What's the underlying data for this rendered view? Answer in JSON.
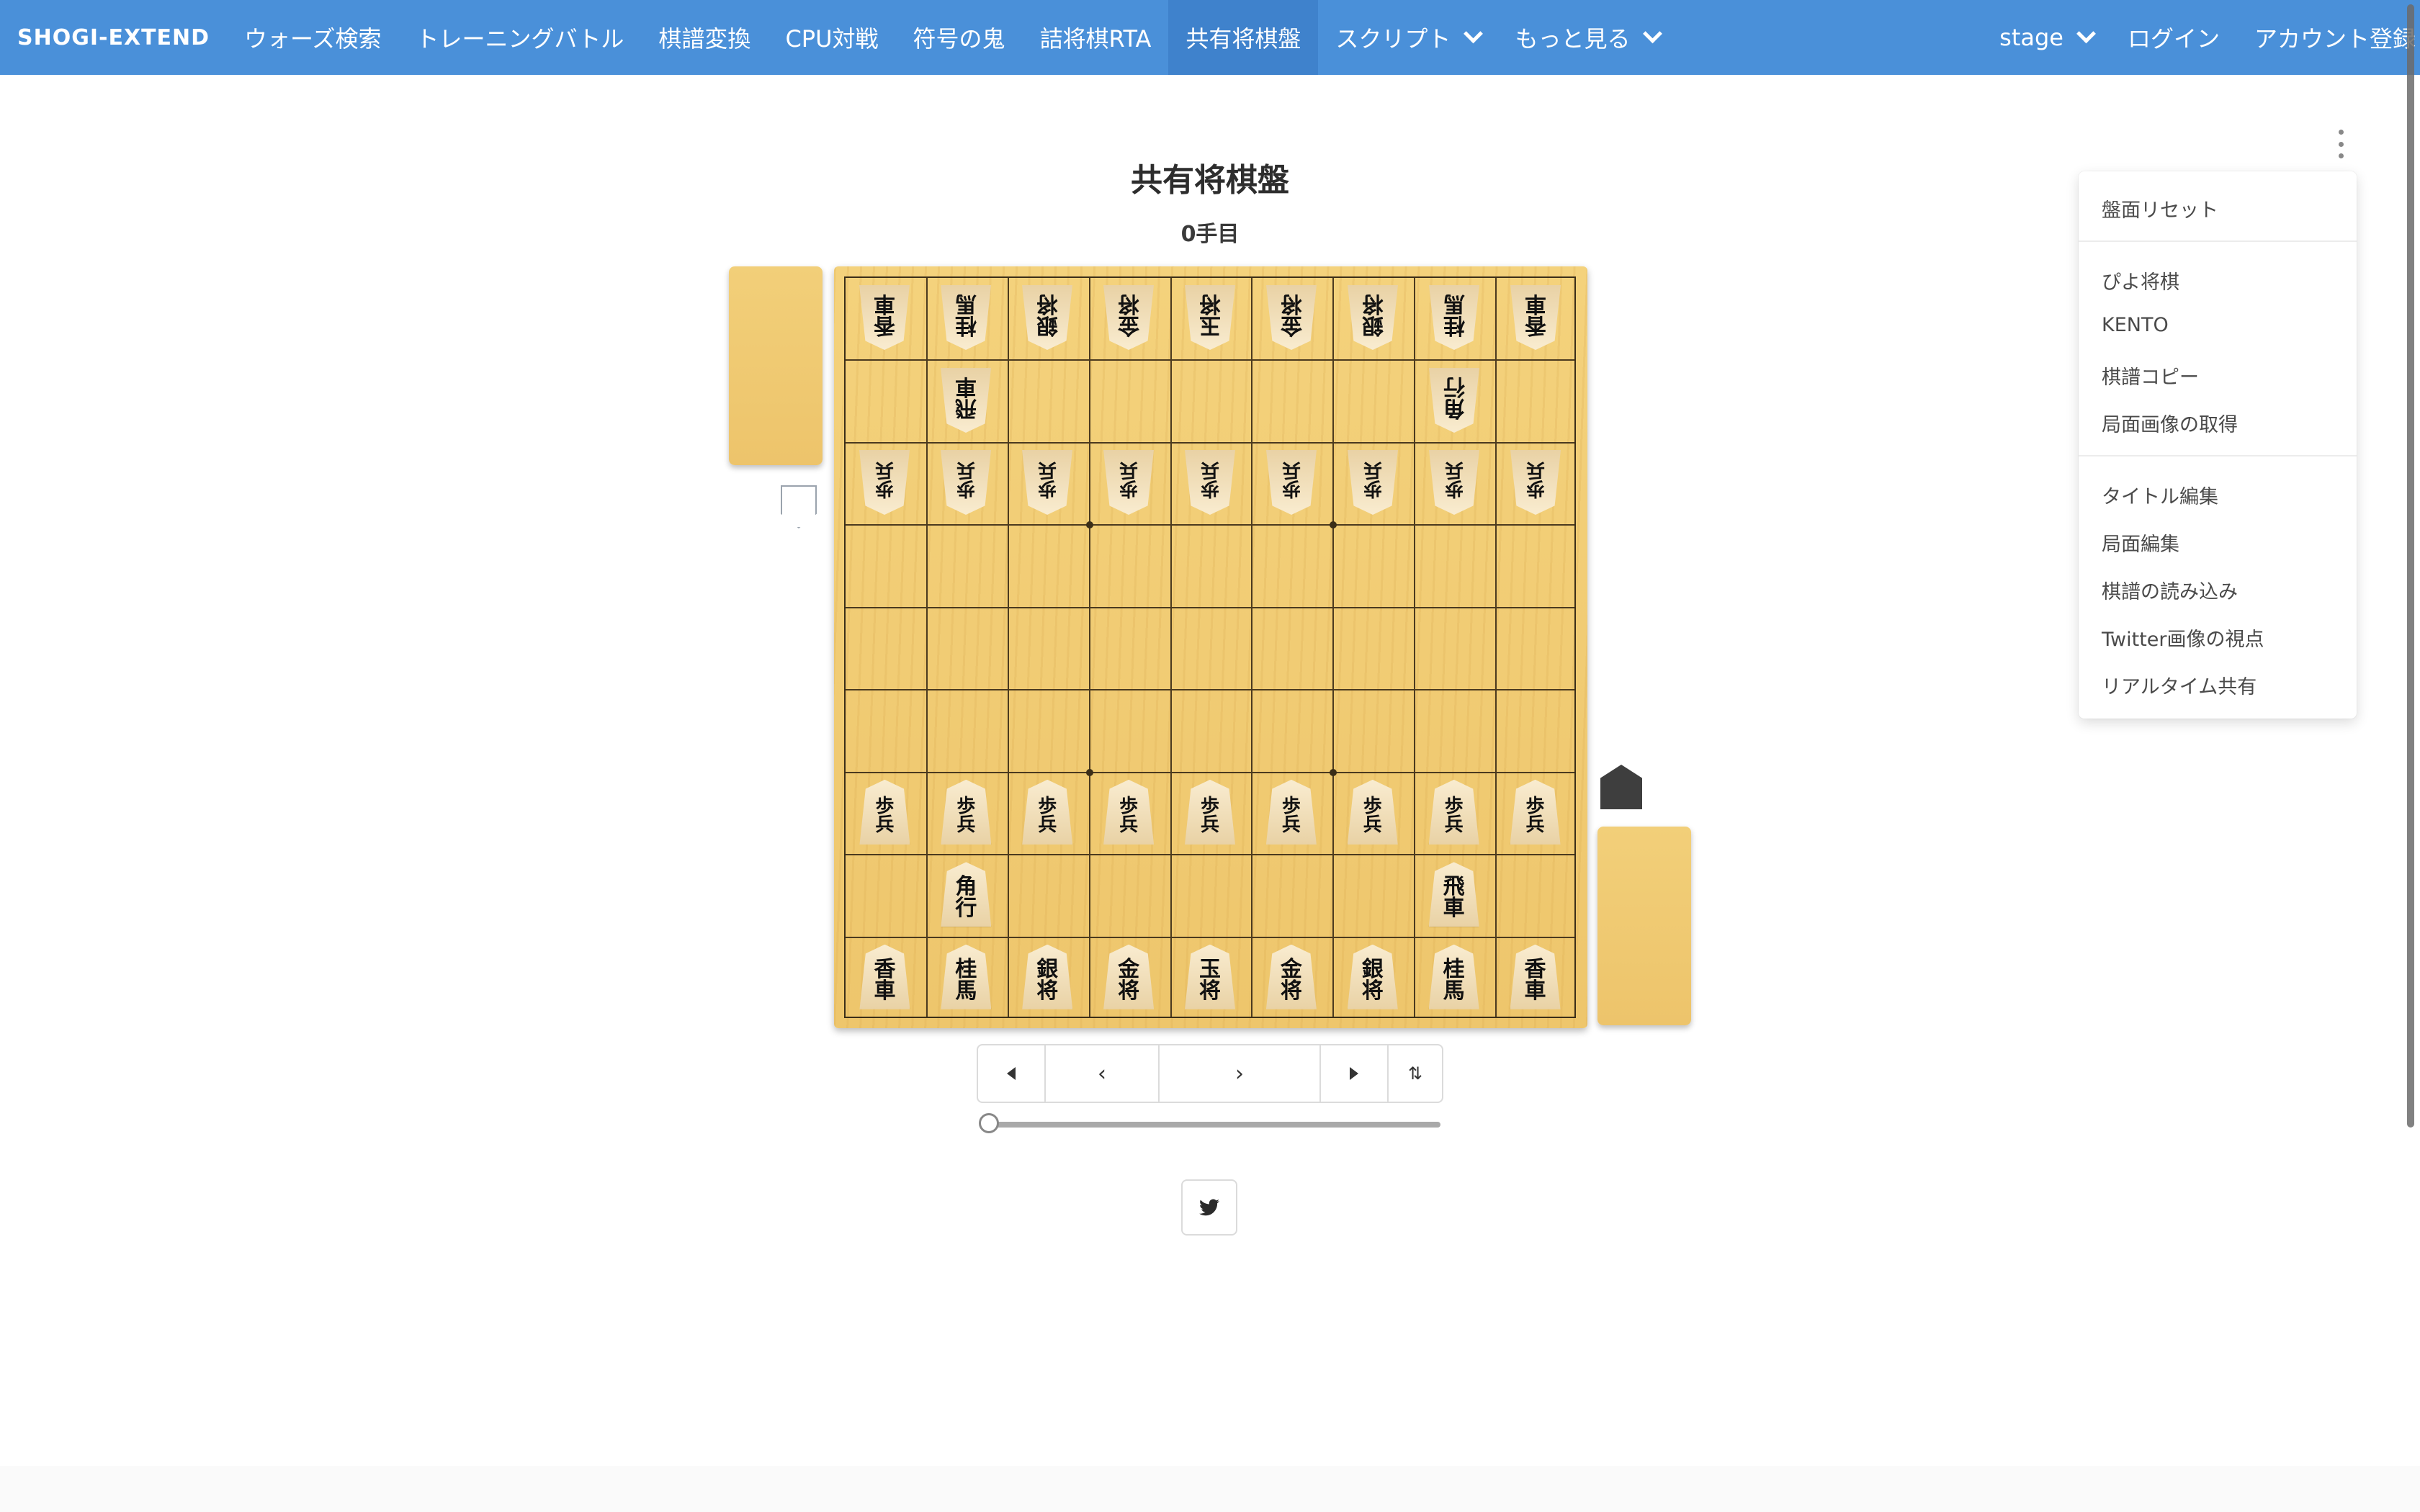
{
  "navbar": {
    "brand": "SHOGI-EXTEND",
    "items": [
      {
        "label": "ウォーズ検索"
      },
      {
        "label": "トレーニングバトル"
      },
      {
        "label": "棋譜変換"
      },
      {
        "label": "CPU対戦"
      },
      {
        "label": "符号の鬼"
      },
      {
        "label": "詰将棋RTA"
      },
      {
        "label": "共有将棋盤",
        "active": true
      },
      {
        "label": "スクリプト",
        "dropdown": true
      },
      {
        "label": "もっと見る",
        "dropdown": true
      }
    ],
    "right": {
      "stage": "stage",
      "login": "ログイン",
      "signup": "アカウント登録"
    },
    "color": "#4a90d9"
  },
  "page": {
    "title": "共有将棋盤",
    "move_label": "0手目"
  },
  "board": {
    "gote_rank1": [
      "香車",
      "桂馬",
      "銀将",
      "金将",
      "玉将",
      "金将",
      "銀将",
      "桂馬",
      "香車"
    ],
    "gote_rank2": {
      "rook": "飛車",
      "bishop": "角行"
    },
    "pawn": "歩兵",
    "sente_rank8": {
      "bishop": "角行",
      "rook": "飛車"
    },
    "sente_rank9": [
      "香車",
      "桂馬",
      "銀将",
      "金将",
      "玉将",
      "金将",
      "銀将",
      "桂馬",
      "香車"
    ]
  },
  "controls": {
    "icons": [
      "first-move-icon",
      "prev-move-icon",
      "next-move-icon",
      "last-move-icon",
      "flip-board-icon"
    ],
    "prev_glyph": "‹",
    "next_glyph": "›",
    "flip_glyph": "⇅",
    "slider_value": 0
  },
  "menu": {
    "items": [
      "盤面リセット",
      "ぴよ将棋",
      "KENTO",
      "棋譜コピー",
      "局面画像の取得",
      "タイトル編集",
      "局面編集",
      "棋譜の読み込み",
      "Twitter画像の視点",
      "リアルタイム共有"
    ]
  }
}
